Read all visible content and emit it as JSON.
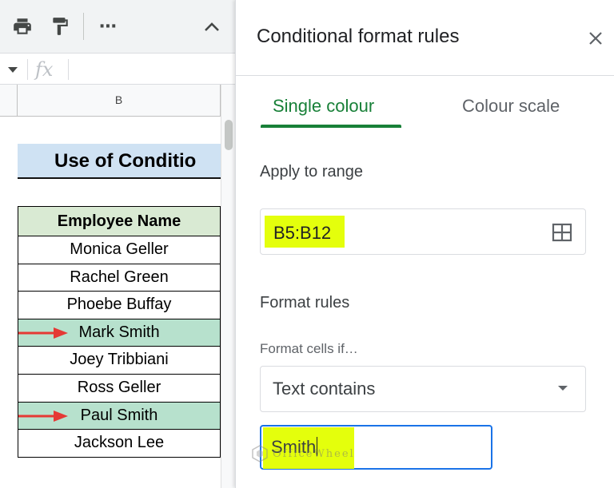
{
  "toolbar": {
    "icons": [
      "print-icon",
      "paint-format-icon",
      "more-icon",
      "collapse-icon"
    ],
    "more_label": "⋯"
  },
  "formula_bar": {
    "fx": "fx"
  },
  "column_header": {
    "label": "B"
  },
  "sheet": {
    "title": "Use of Conditio",
    "table_header": "Employee Name",
    "rows": [
      {
        "name": "Monica Geller",
        "highlighted": false
      },
      {
        "name": "Rachel Green",
        "highlighted": false
      },
      {
        "name": "Phoebe Buffay",
        "highlighted": false
      },
      {
        "name": "Mark Smith",
        "highlighted": true
      },
      {
        "name": "Joey Tribbiani",
        "highlighted": false
      },
      {
        "name": "Ross Geller",
        "highlighted": false
      },
      {
        "name": "Paul Smith",
        "highlighted": true
      },
      {
        "name": "Jackson Lee",
        "highlighted": false
      }
    ],
    "highlight_color": "#b7e1cd",
    "arrow_color": "#e53935"
  },
  "panel": {
    "title": "Conditional format rules",
    "tabs": [
      {
        "label": "Single colour",
        "active": true
      },
      {
        "label": "Colour scale",
        "active": false
      }
    ],
    "apply_to_range_label": "Apply to range",
    "range_value": "B5:B12",
    "format_rules_label": "Format rules",
    "format_cells_if_label": "Format cells if…",
    "condition": "Text contains",
    "value": "Smith",
    "accent_color": "#188038",
    "highlight_marker_color": "#e4ff0c"
  },
  "watermark": "OfficeWheel"
}
